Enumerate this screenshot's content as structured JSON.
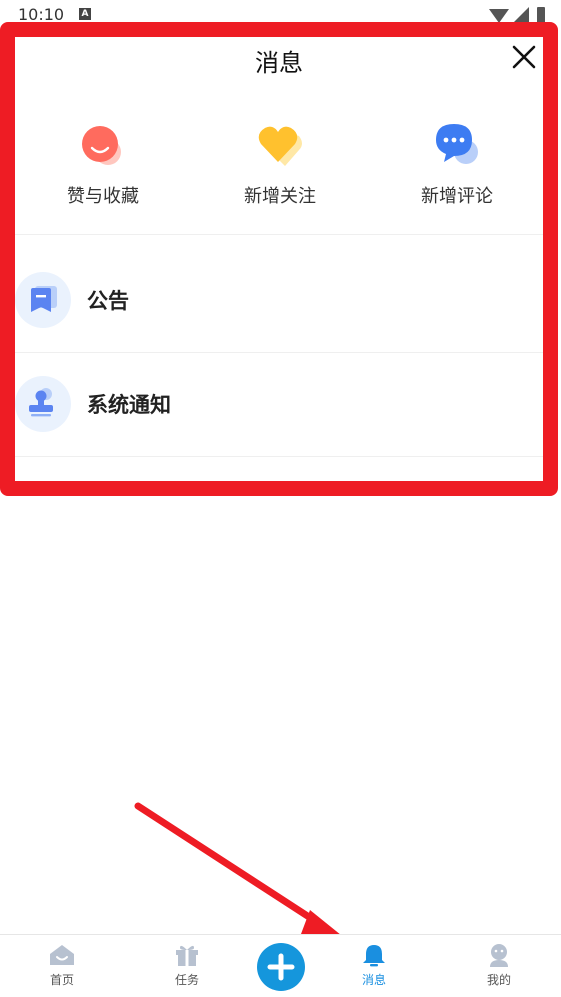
{
  "status_bar": {
    "time": "10:10",
    "notif_badge": "A"
  },
  "panel": {
    "title": "消息",
    "quick_actions": [
      {
        "label": "赞与收藏",
        "icon": "smile-face-icon",
        "color": "#ff6b5e"
      },
      {
        "label": "新增关注",
        "icon": "heart-icon",
        "color": "#ffc12e"
      },
      {
        "label": "新增评论",
        "icon": "chat-bubble-icon",
        "color": "#3d7cf2"
      }
    ],
    "list": [
      {
        "label": "公告",
        "icon": "announcement-icon"
      },
      {
        "label": "系统通知",
        "icon": "stamp-icon"
      }
    ]
  },
  "bottom_nav": {
    "items": [
      {
        "label": "首页",
        "icon": "home-icon"
      },
      {
        "label": "任务",
        "icon": "gift-icon"
      },
      {
        "label": "消息",
        "icon": "bell-icon",
        "active": true
      },
      {
        "label": "我的",
        "icon": "profile-icon"
      }
    ],
    "add_button_icon": "plus-icon"
  },
  "colors": {
    "highlight": "#ee1c24",
    "accent": "#1596dc",
    "active_tab": "#1a8fe0"
  }
}
